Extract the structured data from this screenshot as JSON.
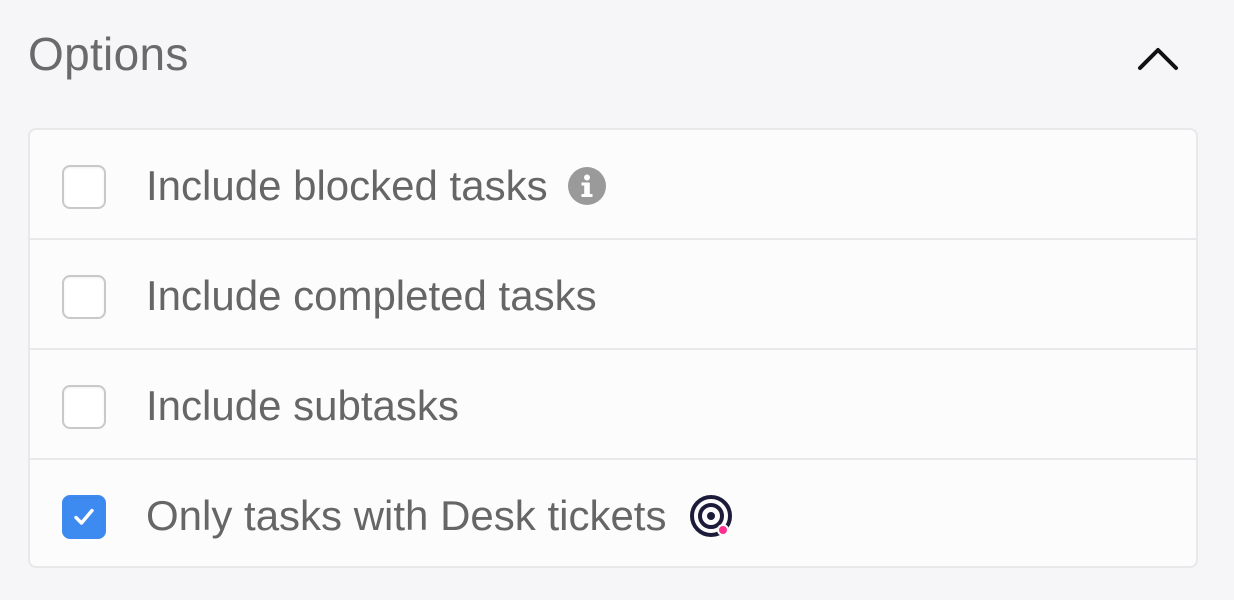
{
  "panel": {
    "title": "Options",
    "toggle_icon": "chevron-up-icon"
  },
  "colors": {
    "background": "#f6f6f8",
    "card": "#fcfcfc",
    "border": "#e8e8ea",
    "text": "#666666",
    "checkbox_checked": "#3d8bf0",
    "info_icon": "#9a9a9a",
    "desk_icon": "#1d1b3a",
    "desk_icon_dot": "#ff2e8f"
  },
  "options": [
    {
      "label": "Include blocked tasks",
      "checked": false,
      "icon": "info-icon"
    },
    {
      "label": "Include completed tasks",
      "checked": false,
      "icon": null
    },
    {
      "label": "Include subtasks",
      "checked": false,
      "icon": null
    },
    {
      "label": "Only tasks with Desk tickets",
      "checked": true,
      "icon": "desk-logo-icon"
    }
  ]
}
